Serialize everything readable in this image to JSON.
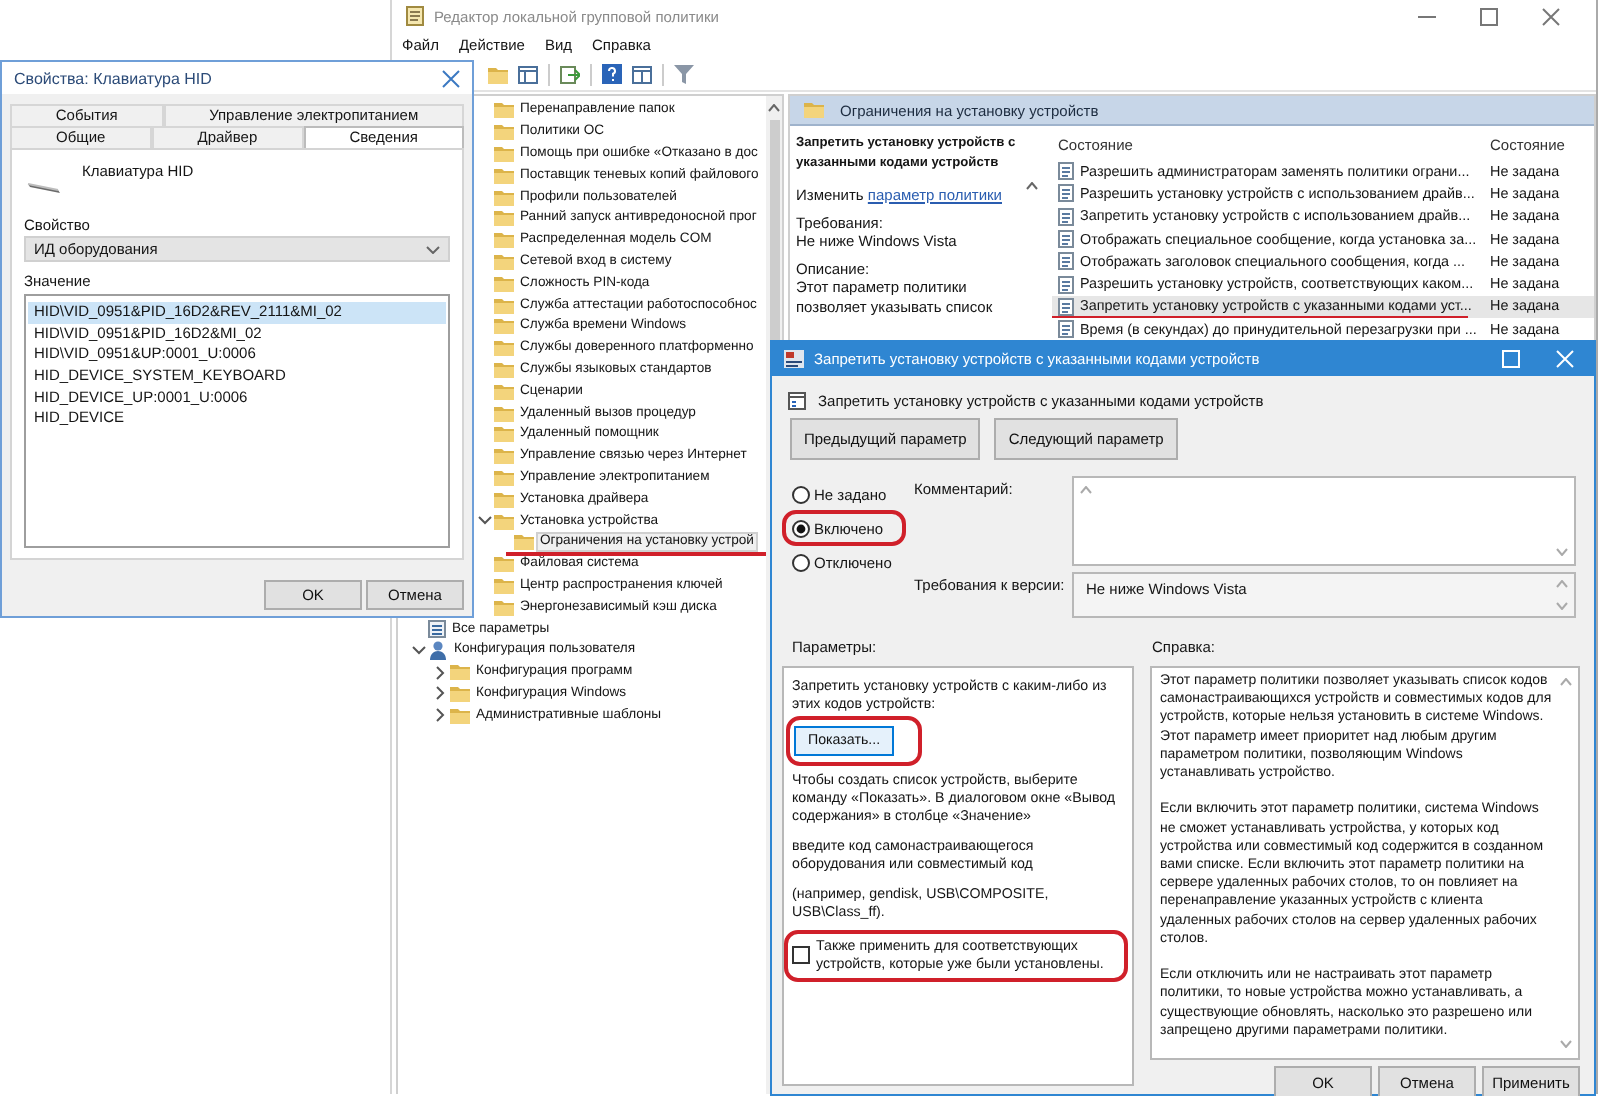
{
  "main_window": {
    "title": "Редактор локальной групповой политики",
    "menu": [
      "Файл",
      "Действие",
      "Вид",
      "Справка"
    ],
    "tree": {
      "branch": [
        {
          "label": "Перенаправление папок",
          "selected": false
        },
        {
          "label": "Политики ОС",
          "selected": false
        },
        {
          "label": "Помощь при ошибке «Отказано в дос",
          "selected": false
        },
        {
          "label": "Поставщик теневых копий файлового",
          "selected": false
        },
        {
          "label": "Профили пользователей",
          "selected": false
        },
        {
          "label": "Ранний запуск антивредоносной прог",
          "selected": false
        },
        {
          "label": "Распределенная модель COM",
          "selected": false
        },
        {
          "label": "Сетевой вход в систему",
          "selected": false
        },
        {
          "label": "Сложность PIN-кода",
          "selected": false
        },
        {
          "label": "Служба аттестации работоспособнос",
          "selected": false
        },
        {
          "label": "Служба времени Windows",
          "selected": false
        },
        {
          "label": "Службы доверенного платформенно",
          "selected": false
        },
        {
          "label": "Службы языковых стандартов",
          "selected": false
        },
        {
          "label": "Сценарии",
          "selected": false
        },
        {
          "label": "Удаленный вызов процедур",
          "selected": false
        },
        {
          "label": "Удаленный помощник",
          "selected": false
        },
        {
          "label": "Управление связью через Интернет",
          "selected": false
        },
        {
          "label": "Управление электропитанием",
          "selected": false
        },
        {
          "label": "Установка драйвера",
          "selected": false
        },
        {
          "label": "Установка устройства",
          "selected": false,
          "expanded": true,
          "children": [
            {
              "label": "Ограничения на установку устрой",
              "selected": true,
              "underlined": true
            }
          ]
        },
        {
          "label": "Файловая система",
          "selected": false
        },
        {
          "label": "Центр распространения ключей",
          "selected": false
        },
        {
          "label": "Энергонезависимый кэш диска",
          "selected": false
        }
      ],
      "root": [
        {
          "label": "Все параметры",
          "kind": "settings",
          "selected": false
        },
        {
          "label": "Конфигурация пользователя",
          "kind": "user",
          "selected": false,
          "expanded": true,
          "children": [
            {
              "label": "Конфигурация программ",
              "selected": false,
              "expanded": false
            },
            {
              "label": "Конфигурация Windows",
              "selected": false,
              "expanded": false
            },
            {
              "label": "Административные шаблоны",
              "selected": false,
              "expanded": false
            }
          ]
        }
      ]
    },
    "right_pane": {
      "header": "Ограничения на установку устройств",
      "details": {
        "title": "Запретить установку устройств с указанными кодами устройств",
        "edit_prefix": "Изменить",
        "edit_link": "параметр политики",
        "requirements_label": "Требования:",
        "requirements": "Не ниже Windows Vista",
        "description_label": "Описание:",
        "description": "Этот параметр политики позволяет указывать список"
      },
      "columns": [
        "Состояние",
        "Состояние"
      ],
      "rows": [
        {
          "name": "Разрешить администраторам заменять политики ограни...",
          "state": "Не задана",
          "selected": false,
          "underlined": false
        },
        {
          "name": "Разрешить установку устройств с использованием драйв...",
          "state": "Не задана",
          "selected": false,
          "underlined": false
        },
        {
          "name": "Запретить установку устройств с использованием драйв...",
          "state": "Не задана",
          "selected": false,
          "underlined": false
        },
        {
          "name": "Отображать специальное сообщение, когда установка за...",
          "state": "Не задана",
          "selected": false,
          "underlined": false
        },
        {
          "name": "Отображать заголовок специального сообщения, когда ...",
          "state": "Не задана",
          "selected": false,
          "underlined": false
        },
        {
          "name": "Разрешить установку устройств, соответствующих каком...",
          "state": "Не задана",
          "selected": false,
          "underlined": false
        },
        {
          "name": "Запретить установку устройств с указанными кодами уст...",
          "state": "Не задана",
          "selected": true,
          "underlined": true
        },
        {
          "name": "Время (в секундах) до принудительной перезагрузки при ...",
          "state": "Не задана",
          "selected": false,
          "underlined": false
        }
      ]
    }
  },
  "hid_dialog": {
    "title": "Свойства: Клавиатура HID",
    "tab_rows": [
      {
        "tabs": [
          {
            "label": "События",
            "selected": false
          },
          {
            "label": "Управление электропитанием",
            "selected": false
          }
        ]
      },
      {
        "tabs": [
          {
            "label": "Общие",
            "selected": false
          },
          {
            "label": "Драйвер",
            "selected": false
          },
          {
            "label": "Сведения",
            "selected": true
          }
        ]
      }
    ],
    "device": "Клавиатура HID",
    "property_label": "Свойство",
    "property_value": "ИД оборудования",
    "value_label": "Значение",
    "values": [
      {
        "text": "HID\\VID_0951&PID_16D2&REV_2111&MI_02",
        "selected": true
      },
      {
        "text": "HID\\VID_0951&PID_16D2&MI_02",
        "selected": false
      },
      {
        "text": "HID\\VID_0951&UP:0001_U:0006",
        "selected": false
      },
      {
        "text": "HID_DEVICE_SYSTEM_KEYBOARD",
        "selected": false
      },
      {
        "text": "HID_DEVICE_UP:0001_U:0006",
        "selected": false
      },
      {
        "text": "HID_DEVICE",
        "selected": false
      }
    ],
    "buttons": [
      "OK",
      "Отмена"
    ]
  },
  "policy_dialog": {
    "title": "Запретить установку устройств с указанными кодами устройств",
    "header": "Запретить установку устройств с указанными кодами устройств",
    "nav_buttons": [
      "Предыдущий параметр",
      "Следующий параметр"
    ],
    "options": [
      {
        "label": "Не задано",
        "selected": false,
        "highlighted": false
      },
      {
        "label": "Включено",
        "selected": true,
        "highlighted": true
      },
      {
        "label": "Отключено",
        "selected": false,
        "highlighted": false
      }
    ],
    "comment_label": "Комментарий:",
    "requirements_label": "Требования к версии:",
    "requirements": "Не ниже Windows Vista",
    "params_label": "Параметры:",
    "help_label": "Справка:",
    "params": {
      "intro": "Запретить установку устройств с каким-либо из этих кодов устройств:",
      "show_button": {
        "label": "Показать...",
        "highlighted": true
      },
      "paragraphs": [
        "Чтобы создать список устройств, выберите команду «Показать». В диалоговом окне «Вывод содержания» в столбце «Значение»",
        "введите код самонастраивающегося оборудования или совместимый код",
        "(например, gendisk, USB\\COMPOSITE, USB\\Class_ff)."
      ],
      "checkbox": {
        "label": "Также применить для соответствующих устройств, которые уже были установлены.",
        "checked": false,
        "highlighted": true
      }
    },
    "help": [
      "Этот параметр политики позволяет указывать список кодов самонастраивающихся устройств и совместимых кодов для устройств, которые нельзя установить в системе Windows. Этот параметр имеет приоритет над любым другим параметром политики, позволяющим Windows устанавливать устройство.",
      "Если включить этот параметр политики, система Windows не сможет устанавливать устройства, у которых код устройства или совместимый код содержится в созданном вами списке. Если включить этот параметр политики на сервере удаленных рабочих столов, то он повлияет на перенаправление указанных устройств с клиента удаленных рабочих столов на сервер удаленных рабочих столов.",
      "Если отключить или не настраивать этот параметр политики, то новые устройства можно устанавливать, а существующие обновлять, насколько это разрешено или запрещено другими параметрами политики."
    ],
    "buttons": [
      "OK",
      "Отмена",
      "Применить"
    ]
  }
}
